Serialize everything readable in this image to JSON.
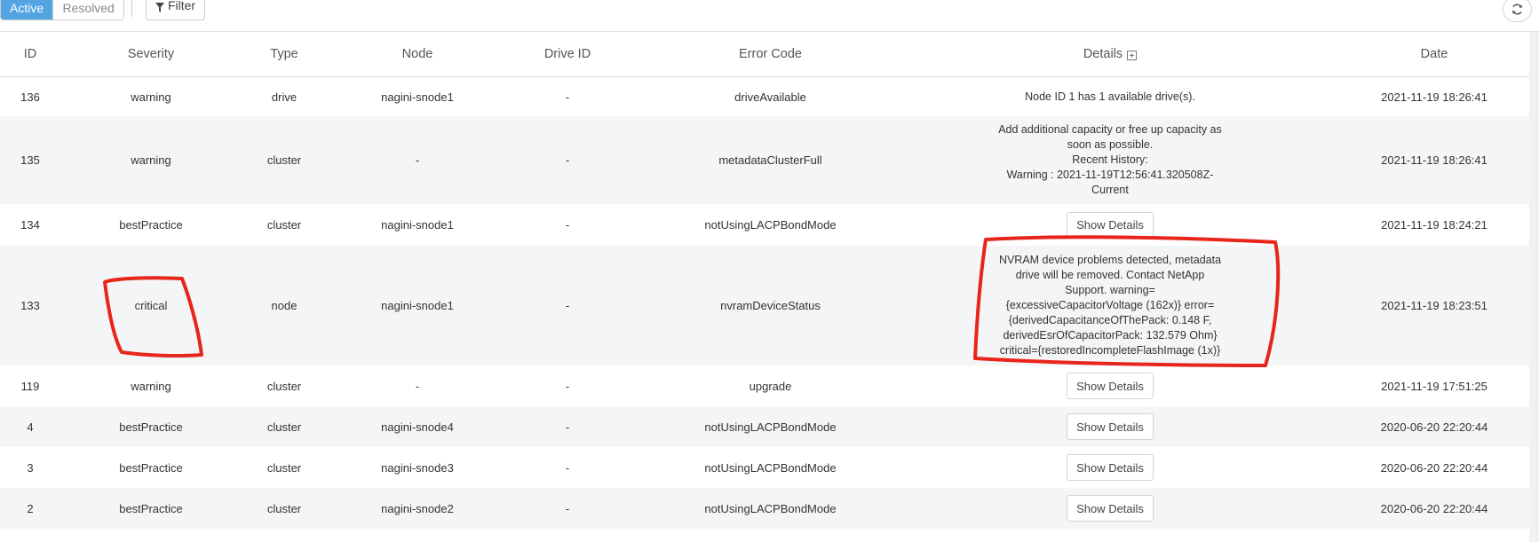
{
  "toolbar": {
    "tab_active": "Active",
    "tab_resolved": "Resolved",
    "filter_label": "Filter",
    "filter_icon": "funnel-icon",
    "refresh_icon": "refresh-icon"
  },
  "table": {
    "headers": [
      "ID",
      "Severity",
      "Type",
      "Node",
      "Drive ID",
      "Error Code",
      "Details",
      "Date"
    ],
    "details_expand_icon": "plus-square-icon",
    "show_details_label": "Show Details",
    "rows": [
      {
        "id": "136",
        "severity": "warning",
        "type": "drive",
        "node": "nagini-snode1",
        "drive": "-",
        "code": "driveAvailable",
        "details": "Node ID 1 has 1 available drive(s).",
        "date": "2021-11-19 18:26:41"
      },
      {
        "id": "135",
        "severity": "warning",
        "type": "cluster",
        "node": "-",
        "drive": "-",
        "code": "metadataClusterFull",
        "details_lines": [
          "Add additional capacity or free up capacity as",
          "soon as possible.",
          "Recent History:",
          "Warning : 2021-11-19T12:56:41.320508Z-",
          "Current"
        ],
        "date": "2021-11-19 18:26:41"
      },
      {
        "id": "134",
        "severity": "bestPractice",
        "type": "cluster",
        "node": "nagini-snode1",
        "drive": "-",
        "code": "notUsingLACPBondMode",
        "date": "2021-11-19 18:24:21"
      },
      {
        "id": "133",
        "severity": "critical",
        "type": "node",
        "node": "nagini-snode1",
        "drive": "-",
        "code": "nvramDeviceStatus",
        "details_lines": [
          "NVRAM device problems detected, metadata",
          "drive will be removed. Contact NetApp",
          "Support. warning=",
          "{excessiveCapacitorVoltage (162x)} error=",
          "{derivedCapacitanceOfThePack: 0.148 F,",
          "derivedEsrOfCapacitorPack: 132.579 Ohm}",
          "critical={restoredIncompleteFlashImage (1x)}"
        ],
        "date": "2021-11-19 18:23:51"
      },
      {
        "id": "119",
        "severity": "warning",
        "type": "cluster",
        "node": "-",
        "drive": "-",
        "code": "upgrade",
        "date": "2021-11-19 17:51:25"
      },
      {
        "id": "4",
        "severity": "bestPractice",
        "type": "cluster",
        "node": "nagini-snode4",
        "drive": "-",
        "code": "notUsingLACPBondMode",
        "date": "2020-06-20 22:20:44"
      },
      {
        "id": "3",
        "severity": "bestPractice",
        "type": "cluster",
        "node": "nagini-snode3",
        "drive": "-",
        "code": "notUsingLACPBondMode",
        "date": "2020-06-20 22:20:44"
      },
      {
        "id": "2",
        "severity": "bestPractice",
        "type": "cluster",
        "node": "nagini-snode2",
        "drive": "-",
        "code": "notUsingLACPBondMode",
        "date": "2020-06-20 22:20:44"
      }
    ]
  },
  "colors": {
    "accent": "#53a5e2",
    "annotation_red": "#e8251b",
    "row_alt": "#f4f5f6"
  }
}
